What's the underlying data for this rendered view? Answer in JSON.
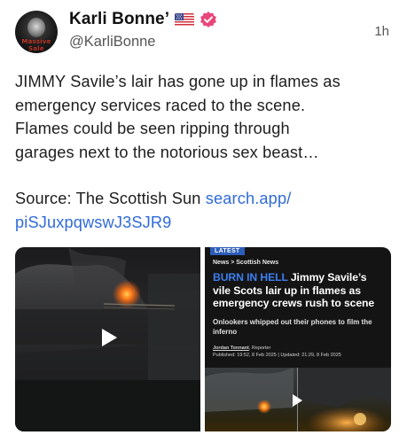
{
  "author": {
    "display_name": "Karli Bonne’",
    "handle": "@KarliBonne",
    "avatar_text": "Massive Sale",
    "flag_icon": "us-flag-icon",
    "verified_icon": "verified-badge-icon",
    "verified_color": "#e8467a"
  },
  "post": {
    "time": "1h",
    "text_lines": [
      "JIMMY Savile’s lair has gone up in flames as",
      "emergency services raced to the scene.",
      "Flames could be seen ripping through",
      "garages next to the notorious sex beast…"
    ],
    "source_label": "Source: The Scottish Sun ",
    "link_line1": "search.app/",
    "link_line2": "piSJuxpqwswJ3SJR9",
    "link_color": "#2f6ad9"
  },
  "media": {
    "video_icon": "play-icon",
    "article": {
      "tag": "LATEST",
      "breadcrumb": "News  >  Scottish News",
      "headline_hot": "BURN IN HELL",
      "headline_rest": " Jimmy Savile’s vile Scots lair up in flames as emergency crews rush to scene",
      "standfirst": "Onlookers whipped out their phones to film the inferno",
      "author": "Jordan Tennant",
      "author_role": ", Reporter",
      "published": "Published: 19:52, 8 Feb 2025  |  Updated: 21:29, 8 Feb 2025",
      "accent_color": "#3c7ff0"
    }
  }
}
